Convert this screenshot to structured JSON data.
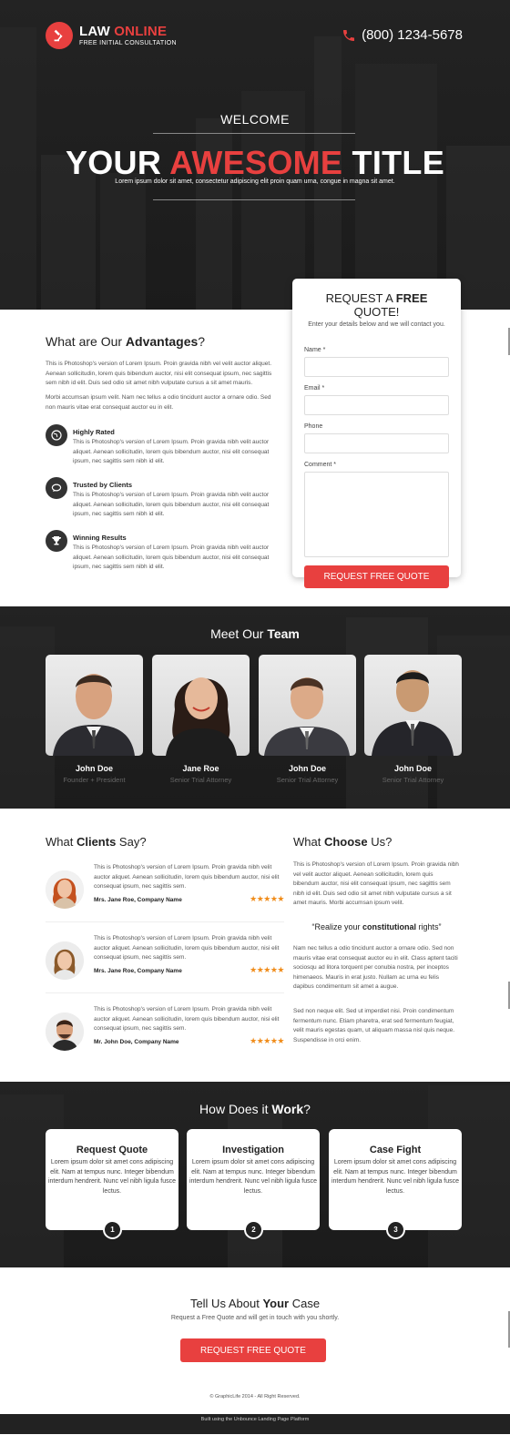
{
  "brand": {
    "logo_first": "LAW ",
    "logo_second": "ONLINE",
    "logo_sub": "FREE INITIAL CONSULTATION",
    "accent": "#e8403f"
  },
  "header": {
    "phone": "(800) 1234-5678"
  },
  "hero": {
    "welcome": "WELCOME",
    "title_part1": "YOUR ",
    "title_highlight": "AWESOME",
    "title_part2": " TITLE",
    "subtitle": "Lorem ipsum dolor sit amet, consectetur adipiscing elit proin quam urna, congue in magna sit amet."
  },
  "quote_form": {
    "title_part1": "REQUEST A ",
    "title_bold": "FREE",
    "title_part2": " QUOTE!",
    "subtitle": "Enter your details below and we will contact you.",
    "fields": [
      {
        "label": "Name *"
      },
      {
        "label": "Email *"
      },
      {
        "label": "Phone"
      },
      {
        "label": "Comment *"
      }
    ],
    "submit": "REQUEST FREE QUOTE"
  },
  "advantages": {
    "title_part1": "What are Our ",
    "title_bold": "Advantages",
    "title_part2": "?",
    "intro1": "This is Photoshop's version  of Lorem Ipsum. Proin gravida nibh vel velit auctor aliquet. Aenean sollicitudin, lorem quis bibendum auctor, nisi elit consequat ipsum, nec sagittis sem nibh id elit. Duis sed odio sit amet nibh vulputate cursus a sit amet mauris.",
    "intro2": "Morbi accumsan ipsum velit. Nam nec tellus a odio tincidunt auctor a ornare odio. Sed non  mauris vitae erat consequat auctor eu in elit.",
    "features": [
      {
        "title": "Highly Rated",
        "text": "This is Photoshop's version  of Lorem Ipsum. Proin gravida nibh velit auctor aliquet. Aenean sollicitudin, lorem quis bibendum auctor, nisi elit consequat ipsum, nec sagittis sem nibh id elit.",
        "icon": "globe-icon"
      },
      {
        "title": "Trusted by Clients",
        "text": "This is Photoshop's version  of Lorem Ipsum. Proin gravida nibh velit auctor aliquet. Aenean sollicitudin, lorem quis bibendum auctor, nisi elit consequat ipsum, nec sagittis sem nibh id elit.",
        "icon": "chat-icon"
      },
      {
        "title": "Winning Results",
        "text": "This is Photoshop's version  of Lorem Ipsum. Proin gravida nibh velit auctor aliquet. Aenean sollicitudin, lorem quis bibendum auctor, nisi elit consequat ipsum, nec sagittis sem nibh id elit.",
        "icon": "trophy-icon"
      }
    ]
  },
  "team": {
    "title_part1": "Meet Our ",
    "title_bold": "Team",
    "members": [
      {
        "name": "John Doe",
        "role": "Founder + President"
      },
      {
        "name": "Jane Roe",
        "role": "Senior Trial Attorney"
      },
      {
        "name": "John Doe",
        "role": "Senior Trial Attorney"
      },
      {
        "name": "John Doe",
        "role": "Senior Trial Attorney"
      }
    ]
  },
  "clients": {
    "title_part1": "What ",
    "title_bold": "Clients",
    "title_part2": " Say?",
    "testimonials": [
      {
        "text": "This is Photoshop's version  of Lorem Ipsum. Proin gravida nibh velit auctor aliquet. Aenean sollicitudin, lorem quis bibendum auctor, nisi elit consequat ipsum, nec sagittis sem.",
        "name": "Mrs. Jane Roe, Company Name",
        "stars": "★★★★★"
      },
      {
        "text": "This is Photoshop's version  of Lorem Ipsum. Proin gravida nibh velit auctor aliquet. Aenean sollicitudin, lorem quis bibendum auctor, nisi elit consequat ipsum, nec sagittis sem.",
        "name": "Mrs. Jane Roe, Company Name",
        "stars": "★★★★★"
      },
      {
        "text": "This is Photoshop's version  of Lorem Ipsum. Proin gravida nibh velit auctor aliquet. Aenean sollicitudin, lorem quis bibendum auctor, nisi elit consequat ipsum, nec sagittis sem.",
        "name": "Mr. John Doe, Company Name",
        "stars": "★★★★★"
      }
    ]
  },
  "why": {
    "title_part1": "What ",
    "title_bold": "Choose",
    "title_part2": " Us?",
    "p1": "This is Photoshop's version  of Lorem Ipsum. Proin gravida nibh vel velit auctor aliquet. Aenean sollicitudin, lorem quis bibendum auctor, nisi elit consequat ipsum, nec sagittis sem nibh id elit. Duis sed odio sit amet nibh vulputate cursus a sit amet mauris. Morbi accumsan ipsum velit.",
    "quote_part1": "“Realize your ",
    "quote_bold": "constitutional",
    "quote_part2": " rights”",
    "p2": "Nam nec tellus a odio tincidunt auctor a ornare odio. Sed non  mauris vitae erat consequat auctor eu in elit. Class aptent taciti sociosqu ad litora torquent per conubia nostra, per inceptos himenaeos. Mauris in erat justo. Nullam ac urna eu felis dapibus condimentum sit amet a augue.",
    "p3": "Sed non neque elit. Sed ut imperdiet nisi. Proin condimentum fermentum nunc. Etiam pharetra, erat sed fermentum feugiat, velit mauris egestas quam, ut aliquam massa nisl quis neque. Suspendisse in orci enim."
  },
  "work": {
    "title_part1": "How Does it ",
    "title_bold": "Work",
    "title_part2": "?",
    "steps": [
      {
        "title": "Request Quote",
        "text": "Lorem ipsum dolor sit amet cons adipiscing elit. Nam at tempus nunc. Integer bibendum interdum hendrerit. Nunc vel nibh ligula fusce lectus.",
        "num": "1"
      },
      {
        "title": "Investigation",
        "text": "Lorem ipsum dolor sit amet cons adipiscing elit. Nam at tempus nunc. Integer bibendum interdum hendrerit. Nunc vel nibh ligula fusce lectus.",
        "num": "2"
      },
      {
        "title": "Case Fight",
        "text": "Lorem ipsum dolor sit amet cons adipiscing elit. Nam at tempus nunc. Integer bibendum interdum hendrerit. Nunc vel nibh ligula fusce lectus.",
        "num": "3"
      }
    ]
  },
  "cta": {
    "title_part1": "Tell Us About ",
    "title_bold": "Your",
    "title_part2": " Case",
    "subtitle": "Request a Free Quote and will get in touch with you shortly.",
    "button": "REQUEST FREE QUOTE",
    "copyright": "© GraphicLife 2014 - All Right Reserved."
  },
  "footer": {
    "text": "Built using the Unbounce Landing Page Platform"
  }
}
